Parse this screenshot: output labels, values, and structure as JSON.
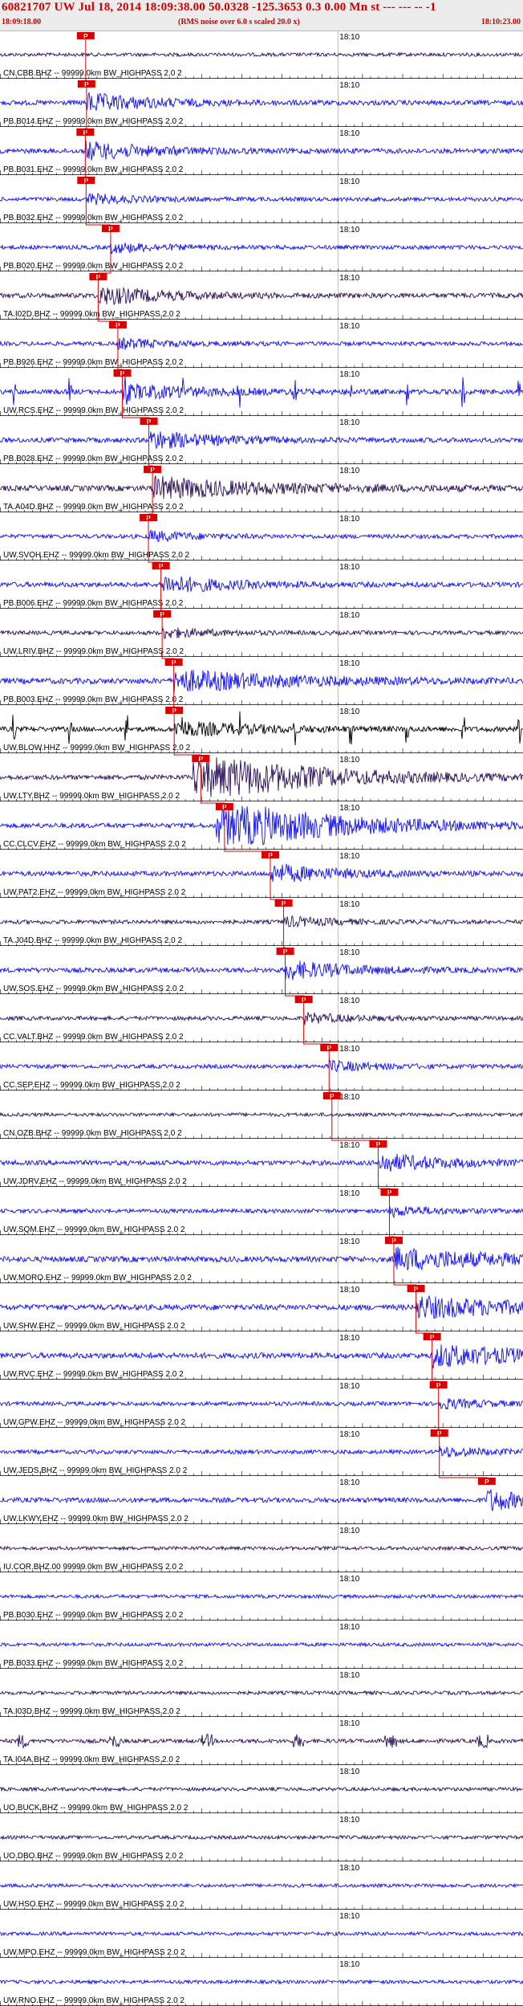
{
  "header": {
    "title": "60821707 UW Jul 18, 2014 18:09:38.00   50.0328 -125.3653  0.3 0.00 Mn st --- --- -- -1",
    "start_time": "18:09:18.00",
    "note": "(RMS noise over 6.0 s scaled 20.0 x)",
    "end_time": "18:10:23.00"
  },
  "colors": {
    "blue": "#1010ee",
    "dark": "#2a0f5a",
    "black": "#000000",
    "pick": "#dd0000"
  },
  "chart_data": {
    "type": "line",
    "title": "60821707 UW Jul 18, 2014 18:09:38.00",
    "x_range": [
      "18:09:18.00",
      "18:10:23.00"
    ],
    "time_marker": "18:10",
    "tick_label_default": "18:10",
    "pick_label": "P",
    "traces": [
      {
        "label": "CN.CBB.BHZ -- 99999.0km BW_HIGHPASS  2.0  2",
        "color": "dark",
        "pick_s": 21.3,
        "energy": "none"
      },
      {
        "label": "PB.B014.EHZ -- 99999.0km BW_HIGHPASS  2.0  2",
        "color": "blue",
        "pick_s": 21.5,
        "energy": "mid"
      },
      {
        "label": "PB.B031.EHZ -- 99999.0km BW_HIGHPASS  2.0  2",
        "color": "blue",
        "pick_s": 21.2,
        "energy": "mid"
      },
      {
        "label": "PB.B032.EHZ -- 99999.0km BW_HIGHPASS  2.0  2",
        "color": "blue",
        "pick_s": 21.4,
        "energy": "low"
      },
      {
        "label": "PB.B020.EHZ -- 99999.0km BW_HIGHPASS  2.0  2",
        "color": "blue",
        "pick_s": 27.5,
        "energy": "low"
      },
      {
        "label": "TA.I02D.BHZ -- 99999.0km BW_HIGHPASS  2.0  2",
        "color": "dark",
        "pick_s": 24.4,
        "energy": "mid"
      },
      {
        "label": "PB.B926.EHZ -- 99999.0km BW_HIGHPASS  2.0  2",
        "color": "blue",
        "pick_s": 29.3,
        "energy": "low"
      },
      {
        "label": "UW.RCS.EHZ -- 99999.0km BW_HIGHPASS  2.0  2",
        "color": "blue",
        "pick_s": 30.4,
        "energy": "spiky"
      },
      {
        "label": "PB.B028.EHZ -- 99999.0km BW_HIGHPASS  2.0  2",
        "color": "blue",
        "pick_s": 37.0,
        "energy": "mid"
      },
      {
        "label": "TA.A04D.BHZ -- 99999.0km BW_HIGHPASS  2.0  2",
        "color": "dark",
        "pick_s": 37.9,
        "energy": "high"
      },
      {
        "label": "UW.SVOH.EHZ -- 99999.0km BW_HIGHPASS  2.0  2",
        "color": "blue",
        "pick_s": 36.9,
        "energy": "low"
      },
      {
        "label": "PB.B006.EHZ -- 99999.0km BW_HIGHPASS  2.0  2",
        "color": "blue",
        "pick_s": 40.0,
        "energy": "mid"
      },
      {
        "label": "UW.LRIV.BHZ -- 99999.0km BW_HIGHPASS  2.0  2",
        "color": "dark",
        "pick_s": 40.3,
        "energy": "low"
      },
      {
        "label": "PB.B003.EHZ -- 99999.0km BW_HIGHPASS  2.0  2",
        "color": "blue",
        "pick_s": 43.2,
        "energy": "high"
      },
      {
        "label": "UW.BLOW.HHZ -- 99999.0km BW_HIGHPASS  2.0  2",
        "color": "black",
        "pick_s": 43.3,
        "energy": "spiky"
      },
      {
        "label": "UW.LTY.BHZ -- 99999.0km BW_HIGHPASS  2.0  2",
        "color": "dark",
        "pick_s": 49.9,
        "energy": "huge"
      },
      {
        "label": "CC.CLCV.EHZ -- 99999.0km BW_HIGHPASS  2.0  2",
        "color": "blue",
        "pick_s": 55.8,
        "energy": "huge"
      },
      {
        "label": "UW.PAT2.EHZ -- 99999.0km BW_HIGHPASS  2.0  2",
        "color": "blue",
        "pick_s": 67.2,
        "energy": "mid"
      },
      {
        "label": "TA.J04D.BHZ -- 99999.0km BW_HIGHPASS  2.0  2",
        "color": "dark",
        "pick_s": 70.5,
        "energy": "low"
      },
      {
        "label": "UW.SOS.EHZ -- 99999.0km BW_HIGHPASS  2.0  2",
        "color": "blue",
        "pick_s": 70.9,
        "energy": "mid"
      },
      {
        "label": "CC.VALT.BHZ -- 99999.0km BW_HIGHPASS  2.0  2",
        "color": "dark",
        "pick_s": 75.5,
        "energy": "low"
      },
      {
        "label": "CC.SEP.EHZ -- 99999.0km BW_HIGHPASS  2.0  2",
        "color": "blue",
        "pick_s": 81.8,
        "energy": "low"
      },
      {
        "label": "CN.OZB.BHZ -- 99999.0km BW_HIGHPASS  2.0  2",
        "color": "dark",
        "pick_s": 82.5,
        "energy": "none"
      },
      {
        "label": "UW.JDRV.EHZ -- 99999.0km BW_HIGHPASS  2.0  2",
        "color": "blue",
        "pick_s": 94.0,
        "energy": "mid"
      },
      {
        "label": "UW.SQM.EHZ -- 99999.0km BW_HIGHPASS  2.0  2",
        "color": "blue",
        "pick_s": 96.8,
        "energy": "low"
      },
      {
        "label": "UW.MORO.EHZ -- 99999.0km BW_HIGHPASS  2.0  2",
        "color": "blue",
        "pick_s": 97.9,
        "energy": "high"
      },
      {
        "label": "UW.SHW.EHZ -- 99999.0km BW_HIGHPASS  2.0  2",
        "color": "blue",
        "pick_s": 103.4,
        "energy": "high"
      },
      {
        "label": "UW.RVC.EHZ -- 99999.0km BW_HIGHPASS  2.0  2",
        "color": "blue",
        "pick_s": 107.4,
        "energy": "high"
      },
      {
        "label": "UW.GPW.EHZ -- 99999.0km BW_HIGHPASS  2.0  2",
        "color": "blue",
        "pick_s": 109.0,
        "energy": "low"
      },
      {
        "label": "UW.JEDS.BHZ -- 99999.0km BW_HIGHPASS  2.0  2",
        "color": "blue",
        "pick_s": 109.2,
        "energy": "low"
      },
      {
        "label": "UW.LKWY.EHZ -- 99999.0km BW_HIGHPASS  2.0  2",
        "color": "blue",
        "pick_s": 121.0,
        "energy": "late"
      },
      {
        "label": "IU.COR.BHZ.00 99999.0km BW_HIGHPASS  2.0  2",
        "color": "dark",
        "pick_s": null,
        "energy": "none"
      },
      {
        "label": "PB.B030.EHZ -- 99999.0km BW_HIGHPASS  2.0  2",
        "color": "blue",
        "pick_s": null,
        "energy": "none"
      },
      {
        "label": "PB.B033.EHZ -- 99999.0km BW_HIGHPASS  2.0  2",
        "color": "blue",
        "pick_s": null,
        "energy": "none"
      },
      {
        "label": "TA.I03D.BHZ -- 99999.0km BW_HIGHPASS  2.0  2",
        "color": "dark",
        "pick_s": null,
        "energy": "none"
      },
      {
        "label": "TA.I04A.BHZ -- 99999.0km BW_HIGHPASS  2.0  2",
        "color": "dark",
        "pick_s": null,
        "energy": "bursty"
      },
      {
        "label": "UO.BUCK.BHZ -- 99999.0km BW_HIGHPASS  2.0  2",
        "color": "dark",
        "pick_s": null,
        "energy": "none"
      },
      {
        "label": "UO.DBO.BHZ -- 99999.0km BW_HIGHPASS  2.0  2",
        "color": "dark",
        "pick_s": null,
        "energy": "none"
      },
      {
        "label": "UW.HSO.EHZ -- 99999.0km BW_HIGHPASS  2.0  2",
        "color": "blue",
        "pick_s": null,
        "energy": "none"
      },
      {
        "label": "UW.MPO.EHZ -- 99999.0km BW_HIGHPASS  2.0  2",
        "color": "blue",
        "pick_s": null,
        "energy": "none"
      },
      {
        "label": "UW.RNO.EHZ -- 99999.0km BW_HIGHPASS  2.0  2",
        "color": "blue",
        "pick_s": null,
        "energy": "none"
      }
    ]
  }
}
